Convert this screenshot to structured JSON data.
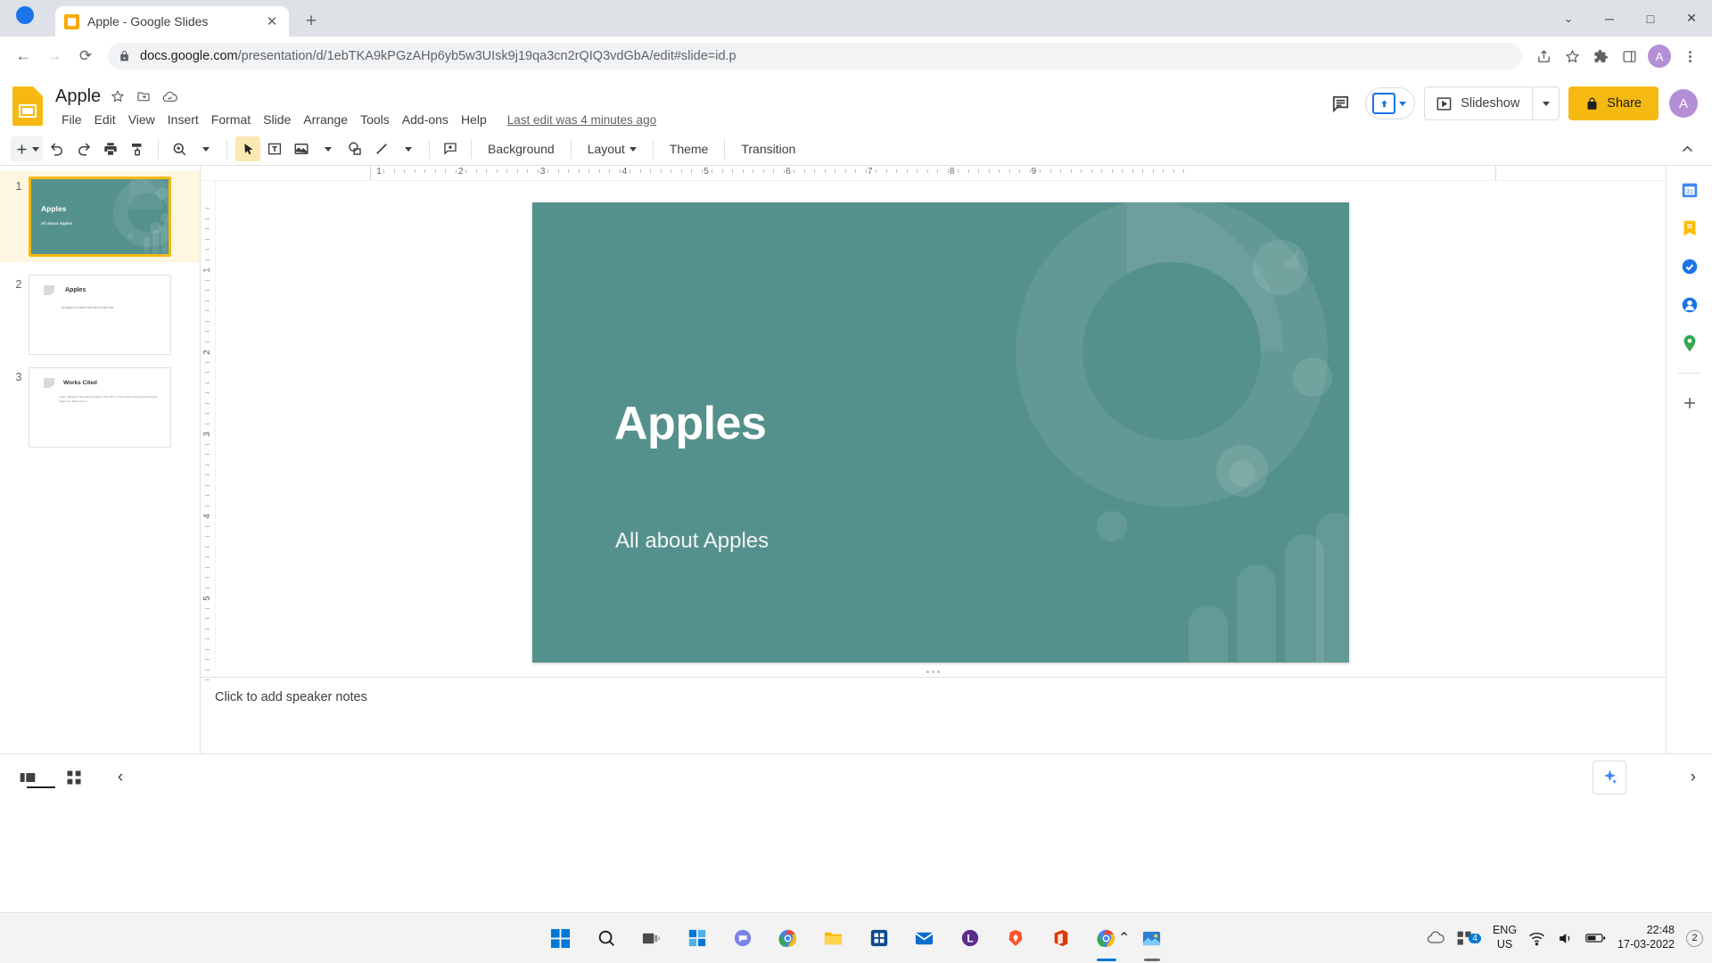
{
  "browser": {
    "tab": {
      "title": "Apple - Google Slides",
      "close_label": "✕",
      "favicon": "slides-favicon"
    },
    "new_tab_label": "+",
    "window_controls": {
      "minimize": "─",
      "maximize": "□",
      "close": "✕",
      "chevron": "⌄"
    },
    "nav": {
      "back": "←",
      "forward": "→",
      "reload": "⟳"
    },
    "url": {
      "domain": "docs.google.com",
      "path": "/presentation/d/1ebTKA9kPGzAHp6yb5w3UIsk9j19qa3cn2rQIQ3vdGbA/edit#slide=id.p"
    },
    "omni_icons": [
      "share-icon",
      "bookmark-star-icon",
      "extensions-puzzle-icon",
      "sidepanel-icon"
    ],
    "profile_initial": "A"
  },
  "slides_header": {
    "doc_title": "Apple",
    "title_icons": [
      "star-icon",
      "move-to-folder-icon",
      "cloud-saved-icon"
    ],
    "menus": [
      "File",
      "Edit",
      "View",
      "Insert",
      "Format",
      "Slide",
      "Arrange",
      "Tools",
      "Add-ons",
      "Help"
    ],
    "last_edit": "Last edit was 4 minutes ago",
    "comment_icon": "comment-history-icon",
    "present_icon": "present-to-other-screen-icon",
    "slideshow_label": "Slideshow",
    "share_label": "Share",
    "avatar_initial": "A"
  },
  "toolbar": {
    "new_slide": "+",
    "icons": [
      "new-slide-icon",
      "new-slide-dropdown",
      "undo-icon",
      "redo-icon",
      "print-icon",
      "paint-format-icon",
      "zoom-icon",
      "zoom-dropdown",
      "select-cursor-icon",
      "text-box-icon",
      "insert-image-icon",
      "image-dropdown",
      "shape-icon",
      "line-icon",
      "line-dropdown",
      "add-comment-icon"
    ],
    "background_label": "Background",
    "layout_label": "Layout",
    "theme_label": "Theme",
    "transition_label": "Transition",
    "collapse_icon": "collapse-toolbar-chevron"
  },
  "filmstrip": {
    "slides": [
      {
        "number": "1",
        "selected": true,
        "type": "teal",
        "title": "Apples",
        "subtitle": "All about Apples"
      },
      {
        "number": "2",
        "selected": false,
        "type": "white",
        "title": "Apples",
        "body": "An Apple is a sweet fruit that is eaten raw."
      },
      {
        "number": "3",
        "selected": false,
        "type": "white",
        "title": "Works Cited",
        "body": "\"Apple.\" Wikipedia, Wikimedia Foundation, 2022. Web. 17 March 2022. Encyclopedia Britannica, \"Apple tree\", Britannica.com"
      }
    ]
  },
  "rulers": {
    "horizontal_marks": [
      "1",
      "2",
      "3",
      "4",
      "5",
      "6",
      "7",
      "8",
      "9"
    ],
    "vertical_marks": [
      "1",
      "2",
      "3",
      "4",
      "5"
    ]
  },
  "slide_canvas": {
    "title": "Apples",
    "subtitle": "All about Apples",
    "background_color": "#55918c",
    "title_color": "#ffffff"
  },
  "notes": {
    "placeholder": "Click to add speaker notes"
  },
  "side_panel": {
    "icons": [
      "calendar-icon",
      "keep-notes-icon",
      "tasks-icon",
      "contacts-icon",
      "maps-icon",
      "add-ons-plus-icon"
    ]
  },
  "bottom_bar": {
    "filmstrip_view_icon": "filmstrip-view-icon",
    "grid_view_icon": "grid-view-icon",
    "collapse_icon": "‹",
    "explore_icon": "explore-sparkle-icon",
    "expand_icon": "›"
  },
  "taskbar": {
    "apps": [
      "start-windows-icon",
      "search-icon",
      "task-view-icon",
      "widgets-icon",
      "teams-chat-icon",
      "chrome-browser-icon",
      "file-explorer-icon",
      "microsoft-store-icon",
      "mail-icon",
      "lightshot-icon",
      "brave-icon",
      "office-icon",
      "chrome-active-icon",
      "photos-icon"
    ],
    "tray": {
      "overflow_arrow": "⌃",
      "cloud_icon": "onedrive-icon",
      "update_badge": "4",
      "language": "ENG",
      "region": "US",
      "network_icon": "wifi-icon",
      "volume_icon": "speaker-icon",
      "battery_icon": "battery-icon",
      "time": "22:48",
      "date": "17-03-2022",
      "notification_count": "2"
    }
  }
}
